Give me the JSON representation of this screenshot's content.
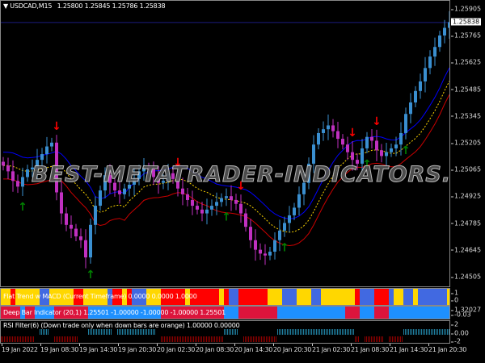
{
  "header": {
    "symbol": "USDCAD,M15",
    "ohlc": "1.25800 1.25845 1.25786 1.25838"
  },
  "watermark": "BEST-METATRADER-INDICATORS.COM",
  "chart_data": {
    "type": "candlestick",
    "symbol": "USDCAD",
    "timeframe": "M15",
    "current_price": 1.25838,
    "ylim": [
      1.2444,
      1.2598
    ],
    "y_ticks": [
      "1.25905",
      "1.25765",
      "1.25625",
      "1.25485",
      "1.25345",
      "1.25205",
      "1.25065",
      "1.24925",
      "1.24785",
      "1.24645",
      "1.24505"
    ],
    "current_price_label": "1.25838",
    "x_ticks": [
      "19 Jan 2022",
      "19 Jan 08:30",
      "19 Jan 14:30",
      "19 Jan 20:30",
      "20 Jan 02:30",
      "20 Jan 08:30",
      "20 Jan 14:30",
      "20 Jan 20:30",
      "21 Jan 02:30",
      "21 Jan 08:30",
      "21 Jan 14:30",
      "21 Jan 20:30"
    ],
    "closes": [
      1.2509,
      1.2506,
      1.2501,
      1.2498,
      1.2503,
      1.2507,
      1.2508,
      1.2512,
      1.2515,
      1.2519,
      1.2521,
      1.2495,
      1.2484,
      1.2478,
      1.2476,
      1.2472,
      1.247,
      1.2461,
      1.2478,
      1.2488,
      1.2496,
      1.2504,
      1.25,
      1.2496,
      1.2494,
      1.2497,
      1.2499,
      1.2502,
      1.2506,
      1.2508,
      1.2507,
      1.2503,
      1.25,
      1.2501,
      1.2505,
      1.2502,
      1.2497,
      1.2494,
      1.2491,
      1.2488,
      1.2486,
      1.2484,
      1.2486,
      1.2488,
      1.249,
      1.2492,
      1.2493,
      1.2491,
      1.2489,
      1.2484,
      1.2477,
      1.247,
      1.2465,
      1.2463,
      1.2462,
      1.2464,
      1.247,
      1.2475,
      1.2479,
      1.2483,
      1.2487,
      1.2494,
      1.25,
      1.251,
      1.252,
      1.2526,
      1.2528,
      1.253,
      1.2527,
      1.2523,
      1.252,
      1.2516,
      1.2512,
      1.251,
      1.2518,
      1.2524,
      1.2522,
      1.2517,
      1.2514,
      1.2516,
      1.2518,
      1.252,
      1.2526,
      1.2536,
      1.2542,
      1.2548,
      1.2553,
      1.256,
      1.2566,
      1.2571,
      1.2577,
      1.2581,
      1.2584
    ],
    "bands": {
      "upper_color": "#0000ff",
      "middle_color": "#ffd700",
      "lower_color": "#cc0000"
    },
    "arrows": {
      "up_bars": [
        4,
        18,
        46,
        58,
        75,
        83
      ],
      "down_bars": [
        11,
        36,
        49,
        72,
        77
      ],
      "up_color": "#008000",
      "down_color": "#ff0000"
    },
    "colors": {
      "bull": "#3a8fd0",
      "bear": "#c030c0",
      "price_line": "#1a1a80"
    }
  },
  "trend_panel": {
    "title": "Flat Trend w MACD (Current Timeframe) 0.0000 0.0000 1.0000",
    "axis": [
      "1",
      "0"
    ],
    "colors": {
      "Y": "#ffd700",
      "R": "#ff0000",
      "B": "#4169e1"
    },
    "segments": [
      [
        0,
        2,
        "Y"
      ],
      [
        2,
        3,
        "R"
      ],
      [
        3,
        8,
        "Y"
      ],
      [
        8,
        10,
        "B"
      ],
      [
        10,
        15,
        "Y"
      ],
      [
        15,
        17,
        "R"
      ],
      [
        17,
        22,
        "Y"
      ],
      [
        22,
        23,
        "B"
      ],
      [
        23,
        25,
        "R"
      ],
      [
        25,
        26,
        "Y"
      ],
      [
        26,
        27,
        "R"
      ],
      [
        27,
        30,
        "B"
      ],
      [
        30,
        33,
        "Y"
      ],
      [
        33,
        34,
        "R"
      ],
      [
        34,
        38,
        "R"
      ],
      [
        38,
        39,
        "Y"
      ],
      [
        39,
        45,
        "R"
      ],
      [
        45,
        46,
        "Y"
      ],
      [
        46,
        47,
        "R"
      ],
      [
        47,
        49,
        "B"
      ],
      [
        49,
        55,
        "R"
      ],
      [
        55,
        58,
        "Y"
      ],
      [
        58,
        61,
        "B"
      ],
      [
        61,
        64,
        "Y"
      ],
      [
        64,
        66,
        "B"
      ],
      [
        66,
        73,
        "Y"
      ],
      [
        73,
        74,
        "R"
      ],
      [
        74,
        77,
        "B"
      ],
      [
        77,
        80,
        "R"
      ],
      [
        80,
        81,
        "B"
      ],
      [
        81,
        83,
        "Y"
      ],
      [
        83,
        85,
        "B"
      ],
      [
        85,
        86,
        "Y"
      ],
      [
        86,
        92,
        "B"
      ],
      [
        92,
        93,
        "Y"
      ]
    ]
  },
  "deepbar_panel": {
    "title": "Deep Bar Indicator (20,1) 1.25501 -1.00000 -1.00000 -1.00000 1.25501",
    "axis": [
      "1.32027",
      "-0.03"
    ],
    "colors": {
      "R": "#dc143c",
      "B": "#1e90ff"
    },
    "segments": [
      [
        0,
        4,
        "R"
      ],
      [
        4,
        5,
        "B"
      ],
      [
        5,
        7,
        "R"
      ],
      [
        7,
        11,
        "B"
      ],
      [
        11,
        18,
        "R"
      ],
      [
        18,
        33,
        "B"
      ],
      [
        33,
        46,
        "R"
      ],
      [
        46,
        49,
        "B"
      ],
      [
        49,
        57,
        "R"
      ],
      [
        57,
        71,
        "B"
      ],
      [
        71,
        74,
        "R"
      ],
      [
        74,
        77,
        "B"
      ],
      [
        77,
        80,
        "R"
      ],
      [
        80,
        93,
        "B"
      ]
    ]
  },
  "rsi_panel": {
    "title": "RSI Filter(6)  (Down trade only when down bars are orange) 1.00000 0.00000",
    "axis": [
      "2",
      "0.00",
      "-2"
    ],
    "up_color": "#1f7fa0",
    "down_color": "#8b0000",
    "up": [
      [
        8,
        10
      ],
      [
        18,
        23
      ],
      [
        24,
        32
      ],
      [
        46,
        49
      ],
      [
        57,
        71
      ],
      [
        71,
        73
      ],
      [
        83,
        93
      ]
    ],
    "down": [
      [
        0,
        4
      ],
      [
        4,
        7
      ],
      [
        11,
        16
      ],
      [
        33,
        34
      ],
      [
        34,
        39
      ],
      [
        39,
        43
      ],
      [
        43,
        46
      ],
      [
        50,
        57
      ],
      [
        73,
        74
      ],
      [
        75,
        76
      ],
      [
        76,
        79
      ],
      [
        80,
        83
      ]
    ]
  }
}
